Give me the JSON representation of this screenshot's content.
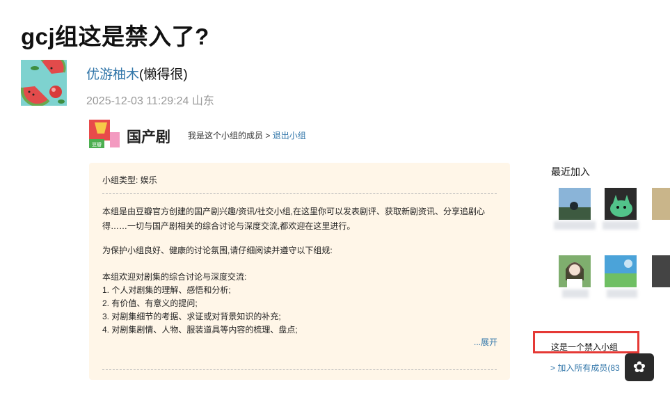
{
  "post": {
    "title": "gcj组这是禁入了?",
    "author": "优游柚木",
    "author_note": "(懒得很)",
    "datetime": "2025-12-03 11:29:24",
    "location": "山东"
  },
  "group": {
    "name": "国产剧",
    "logo_text": "豆瓣",
    "membership_text": "我是这个小组的成员 >",
    "leave_link": "退出小组",
    "type_label": "小组类型:",
    "type_value": "娱乐",
    "description_lines": [
      "本组是由豆瓣官方创建的国产剧兴趣/资讯/社交小组,在这里你可以发表剧评、获取新剧资讯、分享追剧心",
      "得……一切与国产剧相关的综合讨论与深度交流,都欢迎在这里进行。",
      "",
      "为保护小组良好、健康的讨论氛围,请仔细阅读并遵守以下组规:",
      "",
      "本组欢迎对剧集的综合讨论与深度交流:",
      "1. 个人对剧集的理解、感悟和分析;",
      "2. 有价值、有意义的提问;",
      "3. 对剧集细节的考据、求证或对背景知识的补充;",
      "4. 对剧集剧情、人物、服装道具等内容的梳理、盘点;"
    ],
    "expand_label": "...展开"
  },
  "sidebar": {
    "recent_title": "最近加入",
    "banned_notice": "这是一个禁入小组",
    "bottom_link": "> 加入所有成员(83"
  },
  "colors": {
    "link": "#3377aa",
    "panel_bg": "#fff6e8",
    "highlight_border": "#e53935"
  }
}
